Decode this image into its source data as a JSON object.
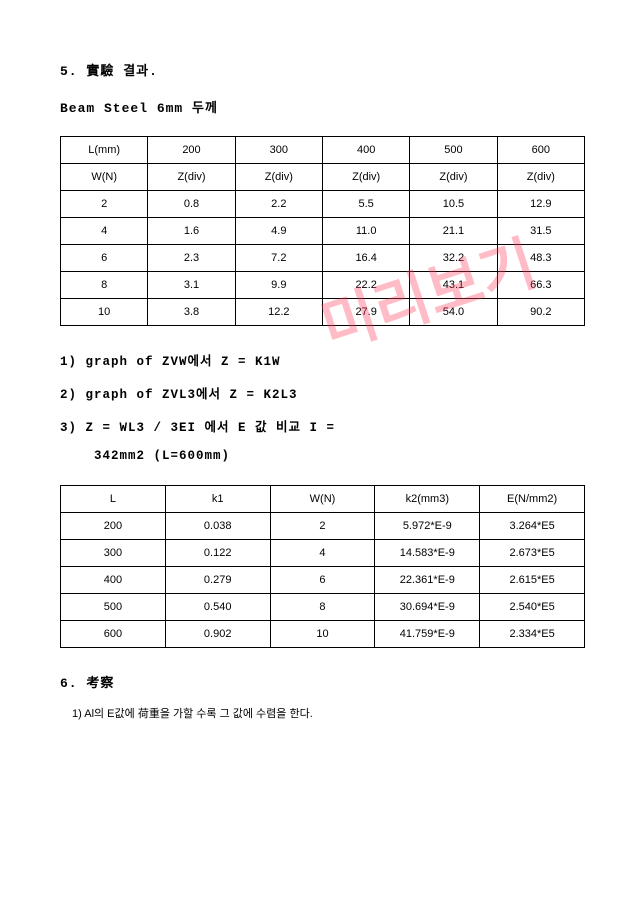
{
  "section5_title": "5. 實驗 결과.",
  "beam_title": "Beam Steel 6mm 두께",
  "table1": {
    "header_row1": [
      "L(mm)",
      "200",
      "300",
      "400",
      "500",
      "600"
    ],
    "header_row2": [
      "W(N)",
      "Z(div)",
      "Z(div)",
      "Z(div)",
      "Z(div)",
      "Z(div)"
    ],
    "rows": [
      [
        "2",
        "0.8",
        "2.2",
        "5.5",
        "10.5",
        "12.9"
      ],
      [
        "4",
        "1.6",
        "4.9",
        "11.0",
        "21.1",
        "31.5"
      ],
      [
        "6",
        "2.3",
        "7.2",
        "16.4",
        "32.2",
        "48.3"
      ],
      [
        "8",
        "3.1",
        "9.9",
        "22.2",
        "43.1",
        "66.3"
      ],
      [
        "10",
        "3.8",
        "12.2",
        "27.9",
        "54.0",
        "90.2"
      ]
    ]
  },
  "list1": "1) graph of ZVW에서 Z = K1W",
  "list2": "2) graph of ZVL3에서 Z = K2L3",
  "list3": "3) Z = WL3 / 3EI 에서 E 값 비교 I =",
  "list3b": "342mm2 (L=600mm)",
  "table2": {
    "header": [
      "L",
      "k1",
      "W(N)",
      "k2(mm3)",
      "E(N/mm2)"
    ],
    "rows": [
      [
        "200",
        "0.038",
        "2",
        "5.972*E-9",
        "3.264*E5"
      ],
      [
        "300",
        "0.122",
        "4",
        "14.583*E-9",
        "2.673*E5"
      ],
      [
        "400",
        "0.279",
        "6",
        "22.361*E-9",
        "2.615*E5"
      ],
      [
        "500",
        "0.540",
        "8",
        "30.694*E-9",
        "2.540*E5"
      ],
      [
        "600",
        "0.902",
        "10",
        "41.759*E-9",
        "2.334*E5"
      ]
    ]
  },
  "section6_title": "6. 考察",
  "note1": "1) Al의 E값에 荷重을 가할 수록 그 값에 수렴을 한다.",
  "watermark_text": "미리보기"
}
